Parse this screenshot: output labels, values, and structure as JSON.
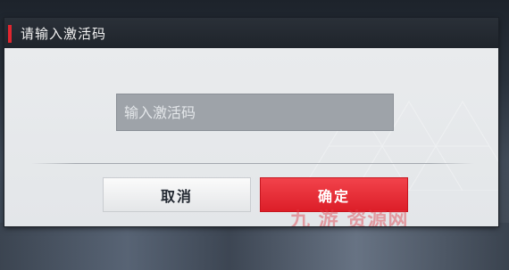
{
  "dialog": {
    "title": "请输入激活码",
    "input": {
      "placeholder": "输入激活码",
      "value": ""
    },
    "cancel_label": "取消",
    "confirm_label": "确定"
  },
  "watermark": {
    "text": "九 游 资源网"
  },
  "colors": {
    "accent": "#e0262f",
    "confirm_button": "#e42a33",
    "header_bg": "#23282f",
    "body_bg": "#e6e8ea",
    "input_bg": "#9ea3a9"
  }
}
